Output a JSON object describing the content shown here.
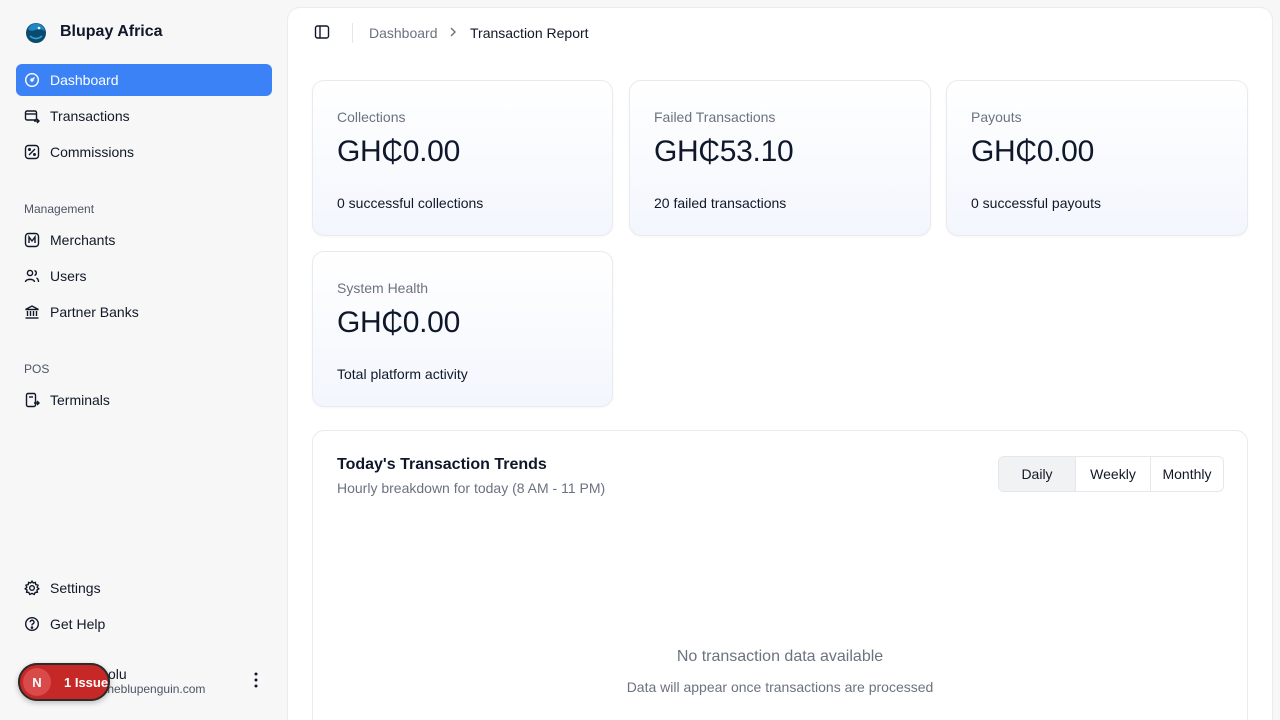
{
  "app": {
    "name": "Blupay Africa"
  },
  "sidebar": {
    "primary": [
      {
        "label": "Dashboard",
        "icon": "gauge-icon",
        "active": true
      },
      {
        "label": "Transactions",
        "icon": "card-transfer-icon"
      },
      {
        "label": "Commissions",
        "icon": "percent-icon"
      }
    ],
    "management_label": "Management",
    "management": [
      {
        "label": "Merchants",
        "icon": "merchant-icon"
      },
      {
        "label": "Users",
        "icon": "users-icon"
      },
      {
        "label": "Partner Banks",
        "icon": "bank-icon"
      }
    ],
    "pos_label": "POS",
    "pos": [
      {
        "label": "Terminals",
        "icon": "terminal-icon"
      }
    ],
    "footer": [
      {
        "label": "Settings",
        "icon": "gear-icon"
      },
      {
        "label": "Get Help",
        "icon": "help-icon"
      }
    ],
    "user": {
      "name": "olu",
      "email": "theblupenguin.com"
    },
    "issue_badge": {
      "initial": "N",
      "label": "1 Issue"
    }
  },
  "breadcrumb": {
    "parent": "Dashboard",
    "current": "Transaction Report"
  },
  "cards": [
    {
      "label": "Collections",
      "value": "GH₵0.00",
      "foot": "0 successful collections"
    },
    {
      "label": "Failed Transactions",
      "value": "GH₵53.10",
      "foot": "20 failed transactions"
    },
    {
      "label": "Payouts",
      "value": "GH₵0.00",
      "foot": "0 successful payouts"
    },
    {
      "label": "System Health",
      "value": "GH₵0.00",
      "foot": "Total platform activity"
    }
  ],
  "trends": {
    "title": "Today's Transaction Trends",
    "subtitle": "Hourly breakdown for today (8 AM - 11 PM)",
    "periods": [
      "Daily",
      "Weekly",
      "Monthly"
    ],
    "selected_period": "Daily",
    "empty_title": "No transaction data available",
    "empty_subtitle": "Data will appear once transactions are processed"
  },
  "colors": {
    "accent": "#3b82f6",
    "issue": "#c62828"
  }
}
